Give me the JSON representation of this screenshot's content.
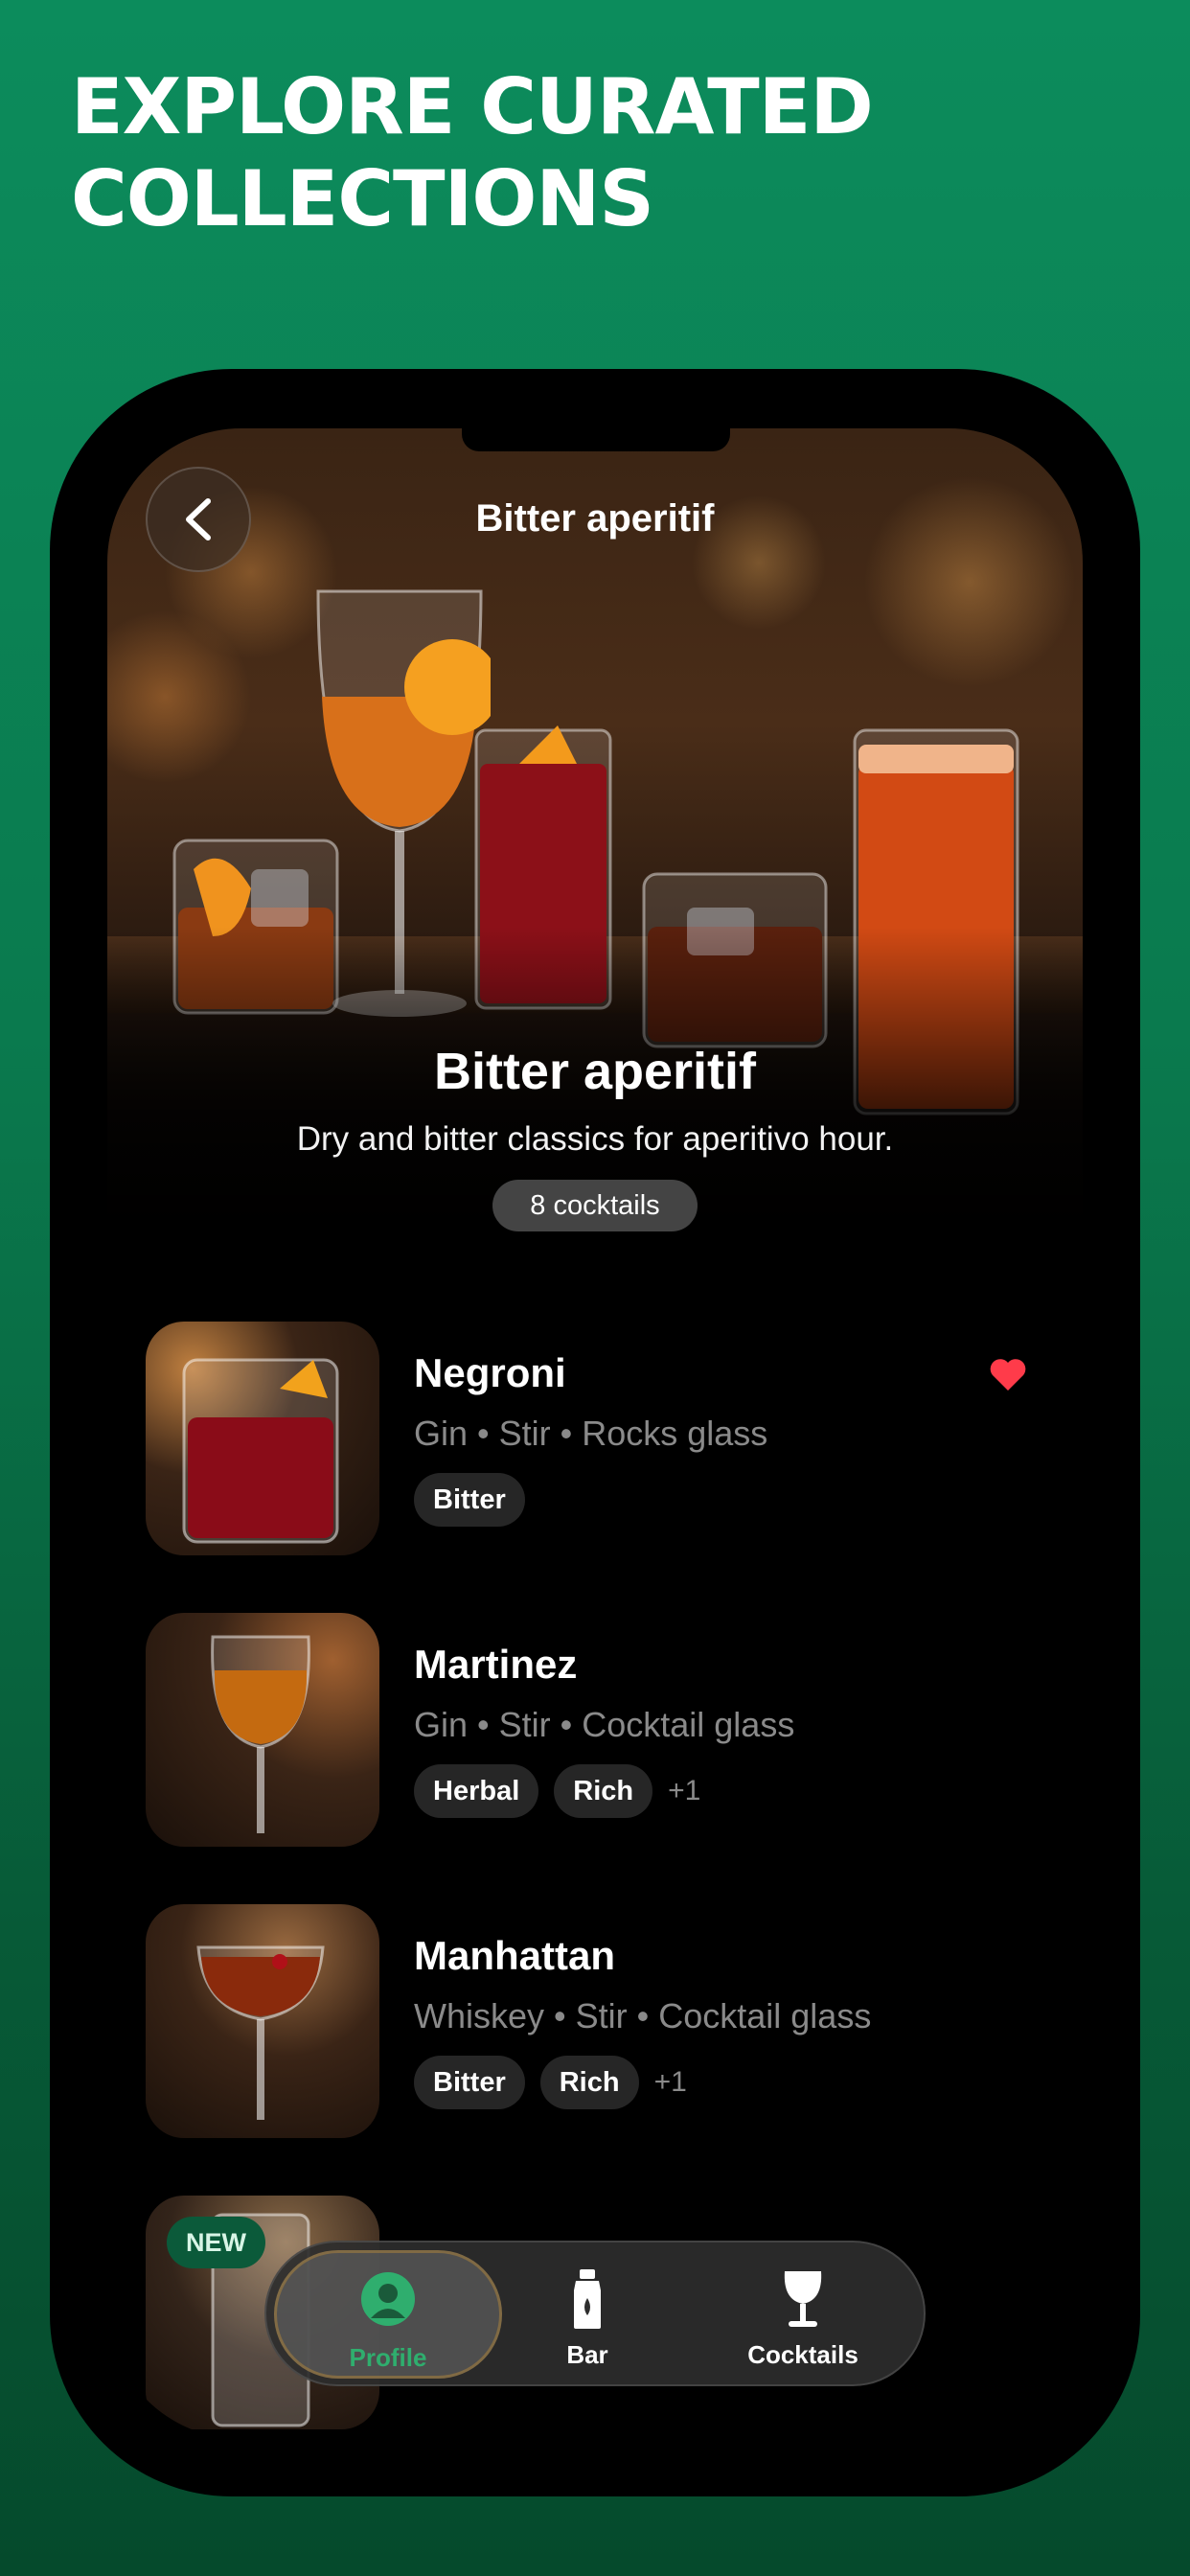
{
  "headline": {
    "line1": "EXPLORE CURATED",
    "line2": "COLLECTIONS"
  },
  "nav": {
    "back_icon": "chevron-left-icon",
    "title": "Bitter aperitif"
  },
  "hero": {
    "title": "Bitter aperitif",
    "subtitle": "Dry and bitter classics for aperitivo hour.",
    "count": "8 cocktails"
  },
  "items": [
    {
      "name": "Negroni",
      "meta": "Gin • Stir • Rocks glass",
      "tags": [
        "Bitter"
      ],
      "more": "",
      "favorite": true,
      "favorite_color": "#ff3b4a"
    },
    {
      "name": "Martinez",
      "meta": "Gin • Stir • Cocktail glass",
      "tags": [
        "Herbal",
        "Rich"
      ],
      "more": "+1",
      "favorite": false
    },
    {
      "name": "Manhattan",
      "meta": "Whiskey • Stir • Cocktail glass",
      "tags": [
        "Bitter",
        "Rich"
      ],
      "more": "+1",
      "favorite": false
    },
    {
      "badge": "NEW"
    }
  ],
  "tabbar": {
    "tabs": [
      {
        "label": "Profile",
        "icon": "profile-icon",
        "active": true,
        "color": "#2fae6e"
      },
      {
        "label": "Bar",
        "icon": "bottle-icon",
        "active": false
      },
      {
        "label": "Cocktails",
        "icon": "wine-glass-icon",
        "active": false
      }
    ]
  },
  "colors": {
    "background_green": "#0c8c5c",
    "accent_green": "#2fae6e",
    "heart_red": "#ff3b4a"
  }
}
